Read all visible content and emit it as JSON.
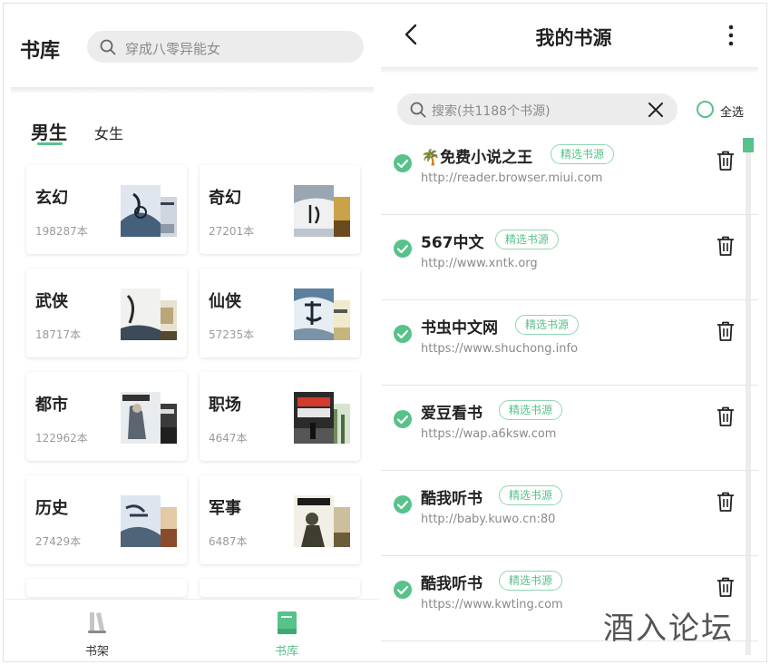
{
  "left": {
    "title": "书库",
    "search_placeholder": "穿成八零异能女",
    "tabs": [
      {
        "label": "男生",
        "active": true
      },
      {
        "label": "女生",
        "active": false
      }
    ],
    "categories": [
      {
        "name": "玄幻",
        "count": "198287本"
      },
      {
        "name": "奇幻",
        "count": "27201本"
      },
      {
        "name": "武侠",
        "count": "18717本"
      },
      {
        "name": "仙侠",
        "count": "57235本"
      },
      {
        "name": "都市",
        "count": "122962本"
      },
      {
        "name": "职场",
        "count": "4647本"
      },
      {
        "name": "历史",
        "count": "27429本"
      },
      {
        "name": "军事",
        "count": "6487本"
      }
    ],
    "nav": [
      {
        "label": "书架",
        "icon": "bookshelf-icon",
        "active": false
      },
      {
        "label": "书库",
        "icon": "library-book-icon",
        "active": true
      }
    ]
  },
  "right": {
    "title": "我的书源",
    "search_placeholder": "搜索(共1188个书源)",
    "select_all_label": "全选",
    "badge_label": "精选书源",
    "sources": [
      {
        "name": "🌴免费小说之王",
        "url": "http://reader.browser.miui.com",
        "checked": true
      },
      {
        "name": "567中文",
        "url": "http://www.xntk.org",
        "checked": true
      },
      {
        "name": "书虫中文网",
        "url": "https://www.shuchong.info",
        "checked": true
      },
      {
        "name": "爱豆看书",
        "url": "https://wap.a6ksw.com",
        "checked": true
      },
      {
        "name": "酷我听书",
        "url": "http://baby.kuwo.cn:80",
        "checked": true
      },
      {
        "name": "酷我听书",
        "url": "https://www.kwting.com",
        "checked": true
      }
    ]
  },
  "colors": {
    "accent": "#57c28a",
    "search_bg": "#ececec",
    "muted_text": "#8a8a8a"
  },
  "watermark": "酒入论坛"
}
